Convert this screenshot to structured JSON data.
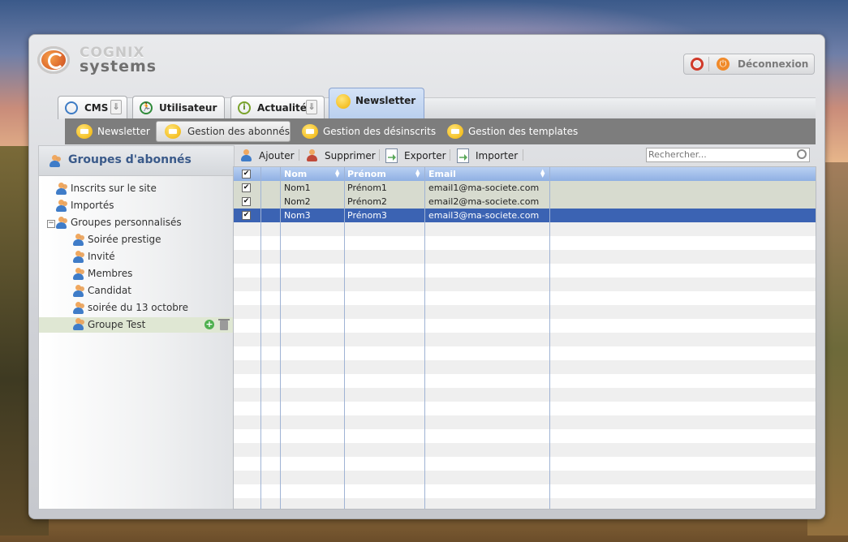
{
  "app": {
    "logo_line1": "COGNIX",
    "logo_line2": "systems"
  },
  "header": {
    "logout_label": "Déconnexion",
    "help_icon": "lifebuoy-icon",
    "power_icon": "power-icon"
  },
  "tabs": [
    {
      "label": "CMS",
      "icon": "gauge-icon"
    },
    {
      "label": "Utilisateur",
      "icon": "runner-icon"
    },
    {
      "label": "Actualité",
      "icon": "info-icon"
    },
    {
      "label": "Newsletter",
      "icon": "envelope-icon",
      "active": true
    }
  ],
  "subnav": [
    {
      "label": "Newsletter"
    },
    {
      "label": "Gestion des abonnés",
      "active": true
    },
    {
      "label": "Gestion des désinscrits"
    },
    {
      "label": "Gestion des templates"
    }
  ],
  "sidebar": {
    "title": "Groupes d'abonnés",
    "items": [
      {
        "label": "Inscrits sur le site"
      },
      {
        "label": "Importés"
      },
      {
        "label": "Groupes personnalisés"
      },
      {
        "label": "Soirée prestige"
      },
      {
        "label": "Invité"
      },
      {
        "label": "Membres"
      },
      {
        "label": "Candidat"
      },
      {
        "label": "soirée du 13 octobre"
      },
      {
        "label": "Groupe Test",
        "selected": true
      }
    ]
  },
  "toolbar": {
    "add": "Ajouter",
    "delete": "Supprimer",
    "export": "Exporter",
    "import": "Importer",
    "search_placeholder": "Rechercher..."
  },
  "table": {
    "columns": [
      "Nom",
      "Prénom",
      "Email"
    ],
    "rows": [
      {
        "nom": "Nom1",
        "prenom": "Prénom1",
        "email": "email1@ma-societe.com",
        "checked": true
      },
      {
        "nom": "Nom2",
        "prenom": "Prénom2",
        "email": "email2@ma-societe.com",
        "checked": true
      },
      {
        "nom": "Nom3",
        "prenom": "Prénom3",
        "email": "email3@ma-societe.com",
        "checked": true,
        "selected": true
      }
    ]
  },
  "colors": {
    "accent": "#3b63b3",
    "header_blue": "#8fb0e3",
    "subnav_gray": "#7d7d7d",
    "title_blue": "#3a5a8a"
  }
}
